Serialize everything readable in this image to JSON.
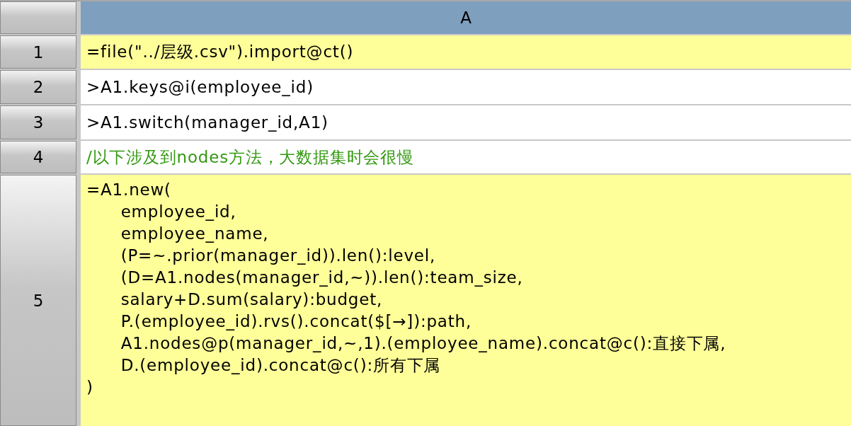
{
  "columns": [
    {
      "label": "A"
    }
  ],
  "rows": [
    {
      "number": "1",
      "cell": {
        "kind": "formula",
        "text": "=file(\"../层级.csv\").import@ct()"
      }
    },
    {
      "number": "2",
      "cell": {
        "kind": "command",
        "text": ">A1.keys@i(employee_id)"
      }
    },
    {
      "number": "3",
      "cell": {
        "kind": "command",
        "text": ">A1.switch(manager_id,A1)"
      }
    },
    {
      "number": "4",
      "cell": {
        "kind": "comment",
        "text": "/以下涉及到nodes方法，大数据集时会很慢"
      }
    },
    {
      "number": "5",
      "cell": {
        "kind": "formula",
        "text": "=A1.new(\n\temployee_id,\n\temployee_name,\n\t(P=~.prior(manager_id)).len():level,\n\t(D=A1.nodes(manager_id,~)).len():team_size,\n\tsalary+D.sum(salary):budget,\n\tP.(employee_id).rvs().concat($[→]):path,\n\tA1.nodes@p(manager_id,~,1).(employee_name).concat@c():直接下属,\n\tD.(employee_id).concat@c():所有下属\n)"
      }
    }
  ]
}
